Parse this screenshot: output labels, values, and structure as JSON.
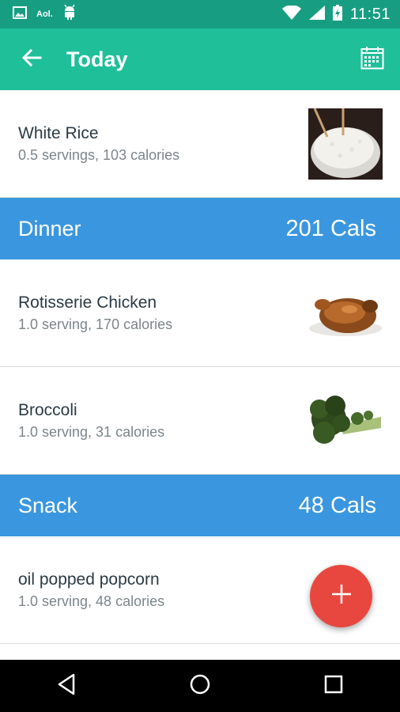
{
  "status_bar": {
    "time": "11:51",
    "aol_label": "Aol.",
    "icons": [
      "image-icon",
      "android-icon",
      "wifi-icon",
      "signal-icon",
      "battery-charging-icon"
    ]
  },
  "app_bar": {
    "title": "Today",
    "back_icon": "arrow-left-icon",
    "calendar_icon": "calendar-icon",
    "color": "#1fbf9a"
  },
  "sections": {
    "first_item": {
      "name": "White Rice",
      "detail": "0.5 servings, 103 calories",
      "image": "white-rice-image"
    },
    "dinner": {
      "name": "Dinner",
      "cals": "201 Cals",
      "items": [
        {
          "name": "Rotisserie Chicken",
          "detail": "1.0 serving, 170 calories",
          "image": "chicken-image"
        },
        {
          "name": "Broccoli",
          "detail": "1.0 serving, 31 calories",
          "image": "broccoli-image"
        }
      ]
    },
    "snack": {
      "name": "Snack",
      "cals": "48 Cals",
      "items": [
        {
          "name": "oil popped popcorn",
          "detail": "1.0 serving, 48 calories",
          "image": "popcorn-image"
        }
      ]
    }
  },
  "fab": {
    "icon": "plus-icon",
    "color": "#e8473f"
  },
  "nav_bar": {
    "icons": [
      "back-triangle-icon",
      "home-circle-icon",
      "recents-square-icon"
    ]
  },
  "colors": {
    "meal_header": "#3a97df",
    "status_bar": "#179e82"
  }
}
